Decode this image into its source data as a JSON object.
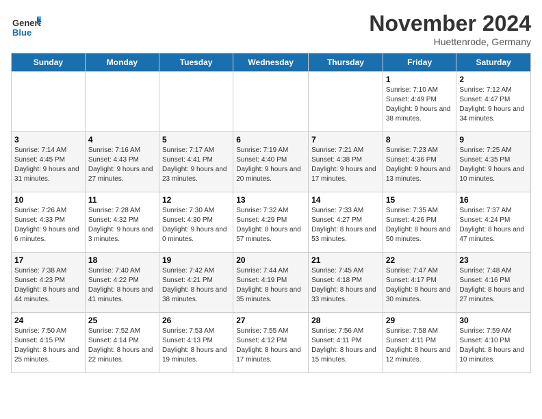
{
  "header": {
    "logo_general": "General",
    "logo_blue": "Blue",
    "month_title": "November 2024",
    "subtitle": "Huettenrode, Germany"
  },
  "days_of_week": [
    "Sunday",
    "Monday",
    "Tuesday",
    "Wednesday",
    "Thursday",
    "Friday",
    "Saturday"
  ],
  "weeks": [
    [
      {
        "day": "",
        "sunrise": "",
        "sunset": "",
        "daylight": ""
      },
      {
        "day": "",
        "sunrise": "",
        "sunset": "",
        "daylight": ""
      },
      {
        "day": "",
        "sunrise": "",
        "sunset": "",
        "daylight": ""
      },
      {
        "day": "",
        "sunrise": "",
        "sunset": "",
        "daylight": ""
      },
      {
        "day": "",
        "sunrise": "",
        "sunset": "",
        "daylight": ""
      },
      {
        "day": "1",
        "sunrise": "Sunrise: 7:10 AM",
        "sunset": "Sunset: 4:49 PM",
        "daylight": "Daylight: 9 hours and 38 minutes."
      },
      {
        "day": "2",
        "sunrise": "Sunrise: 7:12 AM",
        "sunset": "Sunset: 4:47 PM",
        "daylight": "Daylight: 9 hours and 34 minutes."
      }
    ],
    [
      {
        "day": "3",
        "sunrise": "Sunrise: 7:14 AM",
        "sunset": "Sunset: 4:45 PM",
        "daylight": "Daylight: 9 hours and 31 minutes."
      },
      {
        "day": "4",
        "sunrise": "Sunrise: 7:16 AM",
        "sunset": "Sunset: 4:43 PM",
        "daylight": "Daylight: 9 hours and 27 minutes."
      },
      {
        "day": "5",
        "sunrise": "Sunrise: 7:17 AM",
        "sunset": "Sunset: 4:41 PM",
        "daylight": "Daylight: 9 hours and 23 minutes."
      },
      {
        "day": "6",
        "sunrise": "Sunrise: 7:19 AM",
        "sunset": "Sunset: 4:40 PM",
        "daylight": "Daylight: 9 hours and 20 minutes."
      },
      {
        "day": "7",
        "sunrise": "Sunrise: 7:21 AM",
        "sunset": "Sunset: 4:38 PM",
        "daylight": "Daylight: 9 hours and 17 minutes."
      },
      {
        "day": "8",
        "sunrise": "Sunrise: 7:23 AM",
        "sunset": "Sunset: 4:36 PM",
        "daylight": "Daylight: 9 hours and 13 minutes."
      },
      {
        "day": "9",
        "sunrise": "Sunrise: 7:25 AM",
        "sunset": "Sunset: 4:35 PM",
        "daylight": "Daylight: 9 hours and 10 minutes."
      }
    ],
    [
      {
        "day": "10",
        "sunrise": "Sunrise: 7:26 AM",
        "sunset": "Sunset: 4:33 PM",
        "daylight": "Daylight: 9 hours and 6 minutes."
      },
      {
        "day": "11",
        "sunrise": "Sunrise: 7:28 AM",
        "sunset": "Sunset: 4:32 PM",
        "daylight": "Daylight: 9 hours and 3 minutes."
      },
      {
        "day": "12",
        "sunrise": "Sunrise: 7:30 AM",
        "sunset": "Sunset: 4:30 PM",
        "daylight": "Daylight: 9 hours and 0 minutes."
      },
      {
        "day": "13",
        "sunrise": "Sunrise: 7:32 AM",
        "sunset": "Sunset: 4:29 PM",
        "daylight": "Daylight: 8 hours and 57 minutes."
      },
      {
        "day": "14",
        "sunrise": "Sunrise: 7:33 AM",
        "sunset": "Sunset: 4:27 PM",
        "daylight": "Daylight: 8 hours and 53 minutes."
      },
      {
        "day": "15",
        "sunrise": "Sunrise: 7:35 AM",
        "sunset": "Sunset: 4:26 PM",
        "daylight": "Daylight: 8 hours and 50 minutes."
      },
      {
        "day": "16",
        "sunrise": "Sunrise: 7:37 AM",
        "sunset": "Sunset: 4:24 PM",
        "daylight": "Daylight: 8 hours and 47 minutes."
      }
    ],
    [
      {
        "day": "17",
        "sunrise": "Sunrise: 7:38 AM",
        "sunset": "Sunset: 4:23 PM",
        "daylight": "Daylight: 8 hours and 44 minutes."
      },
      {
        "day": "18",
        "sunrise": "Sunrise: 7:40 AM",
        "sunset": "Sunset: 4:22 PM",
        "daylight": "Daylight: 8 hours and 41 minutes."
      },
      {
        "day": "19",
        "sunrise": "Sunrise: 7:42 AM",
        "sunset": "Sunset: 4:21 PM",
        "daylight": "Daylight: 8 hours and 38 minutes."
      },
      {
        "day": "20",
        "sunrise": "Sunrise: 7:44 AM",
        "sunset": "Sunset: 4:19 PM",
        "daylight": "Daylight: 8 hours and 35 minutes."
      },
      {
        "day": "21",
        "sunrise": "Sunrise: 7:45 AM",
        "sunset": "Sunset: 4:18 PM",
        "daylight": "Daylight: 8 hours and 33 minutes."
      },
      {
        "day": "22",
        "sunrise": "Sunrise: 7:47 AM",
        "sunset": "Sunset: 4:17 PM",
        "daylight": "Daylight: 8 hours and 30 minutes."
      },
      {
        "day": "23",
        "sunrise": "Sunrise: 7:48 AM",
        "sunset": "Sunset: 4:16 PM",
        "daylight": "Daylight: 8 hours and 27 minutes."
      }
    ],
    [
      {
        "day": "24",
        "sunrise": "Sunrise: 7:50 AM",
        "sunset": "Sunset: 4:15 PM",
        "daylight": "Daylight: 8 hours and 25 minutes."
      },
      {
        "day": "25",
        "sunrise": "Sunrise: 7:52 AM",
        "sunset": "Sunset: 4:14 PM",
        "daylight": "Daylight: 8 hours and 22 minutes."
      },
      {
        "day": "26",
        "sunrise": "Sunrise: 7:53 AM",
        "sunset": "Sunset: 4:13 PM",
        "daylight": "Daylight: 8 hours and 19 minutes."
      },
      {
        "day": "27",
        "sunrise": "Sunrise: 7:55 AM",
        "sunset": "Sunset: 4:12 PM",
        "daylight": "Daylight: 8 hours and 17 minutes."
      },
      {
        "day": "28",
        "sunrise": "Sunrise: 7:56 AM",
        "sunset": "Sunset: 4:11 PM",
        "daylight": "Daylight: 8 hours and 15 minutes."
      },
      {
        "day": "29",
        "sunrise": "Sunrise: 7:58 AM",
        "sunset": "Sunset: 4:11 PM",
        "daylight": "Daylight: 8 hours and 12 minutes."
      },
      {
        "day": "30",
        "sunrise": "Sunrise: 7:59 AM",
        "sunset": "Sunset: 4:10 PM",
        "daylight": "Daylight: 8 hours and 10 minutes."
      }
    ]
  ]
}
